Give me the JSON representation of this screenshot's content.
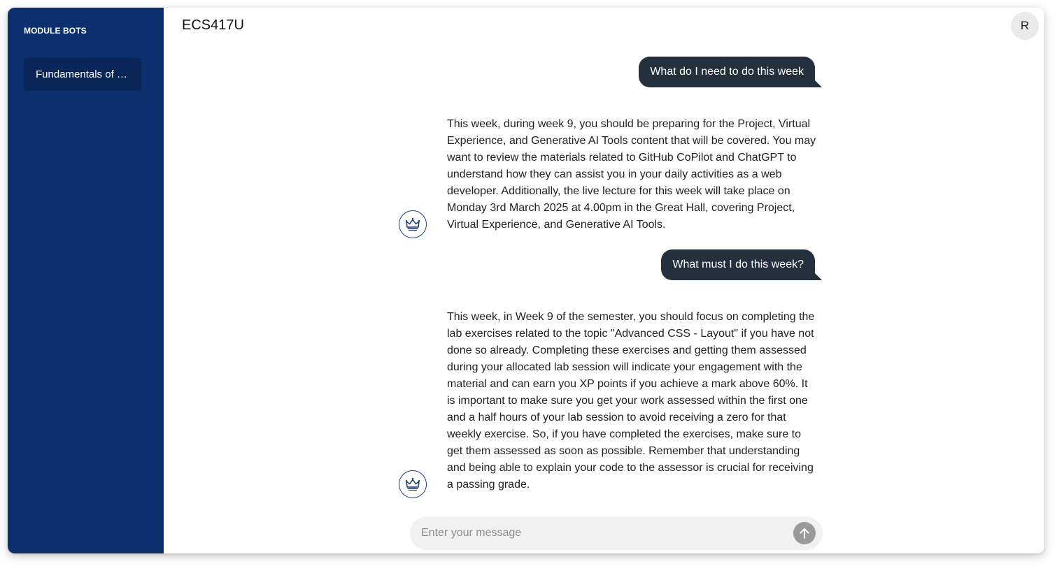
{
  "sidebar": {
    "heading": "MODULE BOTS",
    "items": [
      {
        "label": "Fundamentals of W..."
      }
    ]
  },
  "header": {
    "title": "ECS417U",
    "avatar_initial": "R"
  },
  "conversation": [
    {
      "role": "user",
      "text": "What do I need to do this week"
    },
    {
      "role": "bot",
      "text": "This week, during week 9, you should be preparing for the Project, Virtual Experience, and Generative AI Tools content that will be covered. You may want to review the materials related to GitHub CoPilot and ChatGPT to understand how they can assist you in your daily activities as a web developer. Additionally, the live lecture for this week will take place on Monday 3rd March 2025 at 4.00pm in the Great Hall, covering Project, Virtual Experience, and Generative AI Tools."
    },
    {
      "role": "user",
      "text": "What must I do this week?"
    },
    {
      "role": "bot",
      "text": "This week, in Week 9 of the semester, you should focus on completing the lab exercises related to the topic \"Advanced CSS - Layout\" if you have not done so already. Completing these exercises and getting them assessed during your allocated lab session will indicate your engagement with the material and can earn you XP points if you achieve a mark above 60%. It is important to make sure you get your work assessed within the first one and a half hours of your lab session to avoid receiving a zero for that weekly exercise. So, if you have completed the exercises, make sure to get them assessed as soon as possible. Remember that understanding and being able to explain your code to the assessor is crucial for receiving a passing grade."
    }
  ],
  "composer": {
    "placeholder": "Enter your message",
    "value": ""
  },
  "icons": {
    "bot_avatar": "crown-icon",
    "send": "arrow-up-icon"
  },
  "colors": {
    "sidebar_bg": "#0c2f6d",
    "sidebar_item_bg": "#0a2658",
    "user_bubble_bg": "#25303f",
    "composer_bg": "#f1f1f1",
    "send_button_bg": "#9a9a9a"
  }
}
